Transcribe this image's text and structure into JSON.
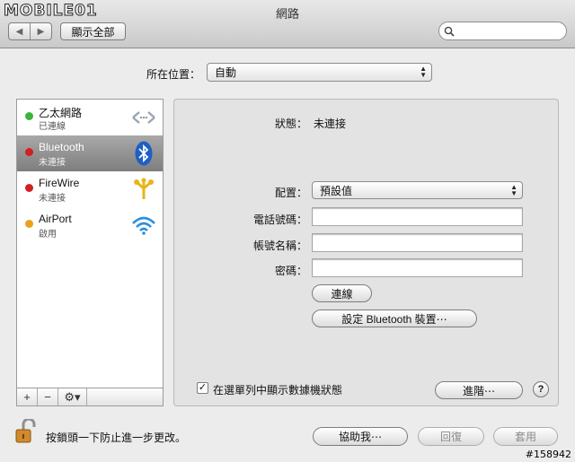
{
  "watermark": {
    "logo": "MOBILE01"
  },
  "window": {
    "title": "網路"
  },
  "toolbar": {
    "back_icon": "◀",
    "forward_icon": "▶",
    "show_all": "顯示全部",
    "search_placeholder": ""
  },
  "location": {
    "label": "所在位置：",
    "value": "自動"
  },
  "services": [
    {
      "name": "乙太網路",
      "status": "已連線",
      "dot_color": "#3bb43b",
      "icon": "ethernet-icon"
    },
    {
      "name": "Bluetooth",
      "status": "未連接",
      "dot_color": "#d22020",
      "icon": "bluetooth-icon"
    },
    {
      "name": "FireWire",
      "status": "未連接",
      "dot_color": "#d22020",
      "icon": "firewire-icon"
    },
    {
      "name": "AirPort",
      "status": "啟用",
      "dot_color": "#e8a21c",
      "icon": "airport-icon"
    }
  ],
  "sidebar_tools": {
    "add": "+",
    "remove": "−",
    "action": "⚙▾"
  },
  "detail": {
    "status_label": "狀態：",
    "status_value": "未連接",
    "config_label": "配置：",
    "config_value": "預設值",
    "phone_label": "電話號碼：",
    "phone_value": "",
    "account_label": "帳號名稱：",
    "account_value": "",
    "password_label": "密碼：",
    "password_value": "",
    "connect_button": "連線",
    "setup_bluetooth_button": "設定 Bluetooth 裝置⋯",
    "show_modem_status_label": "在選單列中顯示數據機狀態",
    "show_modem_status_checked": true,
    "advanced_button": "進階⋯",
    "help_button": "?"
  },
  "footer": {
    "lock_text": "按鎖頭一下防止進一步更改。",
    "assist_button": "協助我⋯",
    "revert_button": "回復",
    "apply_button": "套用"
  },
  "image_id": "#158942"
}
